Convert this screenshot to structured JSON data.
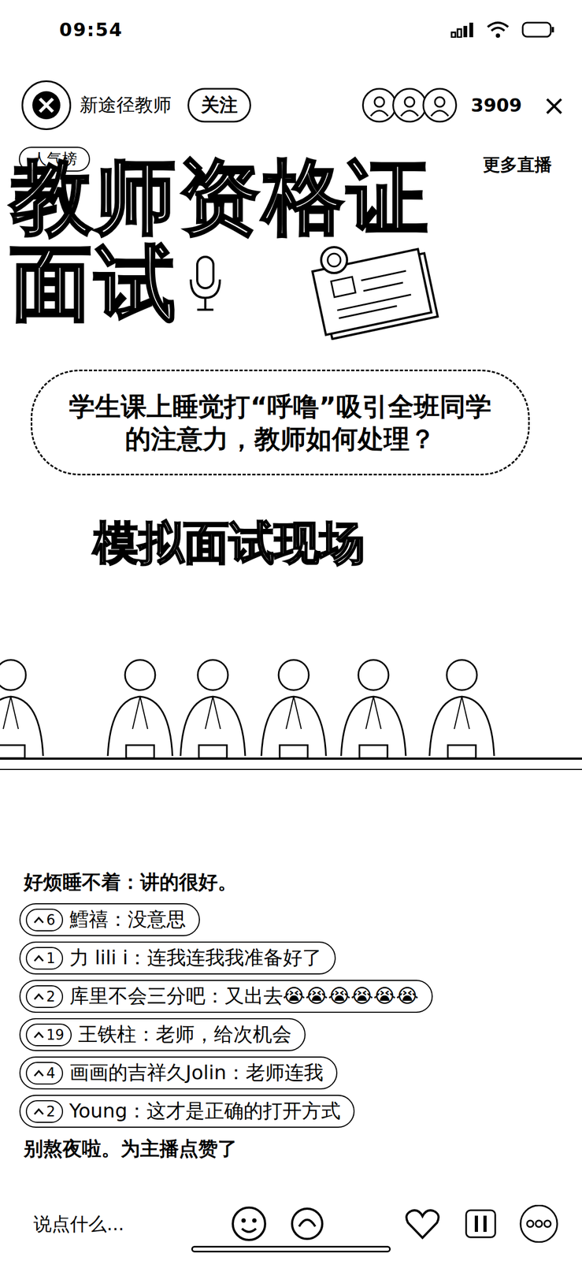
{
  "status_bar": {
    "time": "09:54"
  },
  "header": {
    "name": "新途径教师",
    "follow": "关注",
    "viewers": "3909",
    "close": "×"
  },
  "live": {
    "tag": "人气榜",
    "more": "更多直播"
  },
  "banner": {
    "title_line1": "教师资格证",
    "title_line2": "面试",
    "question": "学生课上睡觉打“呼噜”吸引全班同学的注意力，教师如何处理？",
    "subtitle": "模拟面试现场"
  },
  "comments": [
    {
      "kind": "plain",
      "user": "好烦睡不着：",
      "text": "讲的很好。"
    },
    {
      "kind": "badge",
      "badge": "6",
      "user": "鱈禧：",
      "text": "没意思"
    },
    {
      "kind": "badge",
      "badge": "1",
      "user": "力 lili i：",
      "text": "连我连我我准备好了"
    },
    {
      "kind": "badge",
      "badge": "2",
      "user": "库里不会三分吧：",
      "text": "又出去😭😭😭😭😭😭"
    },
    {
      "kind": "badge",
      "badge": "19",
      "user": "王铁柱：",
      "text": "老师，给次机会"
    },
    {
      "kind": "badge",
      "badge": "4",
      "user": "画画的吉祥久Jolin：",
      "text": "老师连我"
    },
    {
      "kind": "badge",
      "badge": "2",
      "user": "Young：",
      "text": "这才是正确的打开方式"
    },
    {
      "kind": "system",
      "text": "别熬夜啦。为主播点赞了"
    }
  ],
  "composer": {
    "placeholder": "说点什么..."
  }
}
